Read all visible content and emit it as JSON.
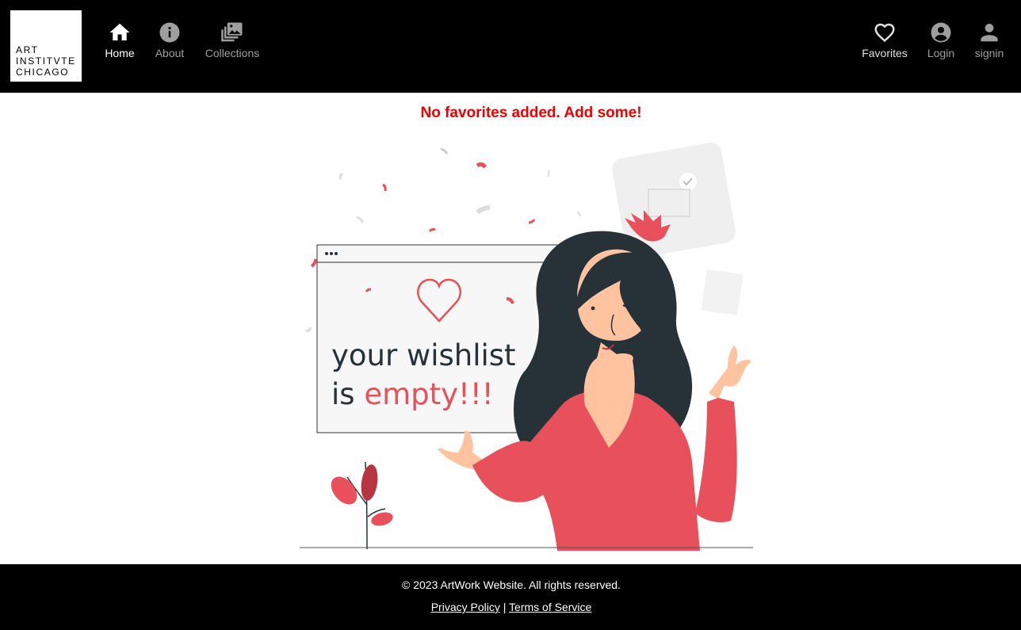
{
  "header": {
    "logo": {
      "lines": [
        "ART",
        "INSTITVTE",
        "CHICAGO"
      ]
    },
    "nav_left": [
      {
        "label": "Home",
        "icon": "home-icon",
        "active": true
      },
      {
        "label": "About",
        "icon": "info-icon",
        "active": false
      },
      {
        "label": "Collections",
        "icon": "collections-icon",
        "active": false
      }
    ],
    "nav_right": [
      {
        "label": "Favorites",
        "icon": "heart-outline-icon"
      },
      {
        "label": "Login",
        "icon": "account-circle-icon"
      },
      {
        "label": "signin",
        "icon": "person-icon"
      }
    ]
  },
  "main": {
    "empty_message": "No favorites added. Add some!",
    "illustration": {
      "line1": "your wishlist",
      "line2_prefix": "is ",
      "line2_accent": "empty!!!",
      "icon": "heart-outline-icon"
    }
  },
  "footer": {
    "copyright": "© 2023 ArtWork Website. All rights reserved.",
    "privacy_label": "Privacy Policy",
    "separator": "|",
    "terms_label": "Terms of Service"
  },
  "colors": {
    "header_bg": "#000000",
    "active_nav": "#ffffff",
    "inactive_nav": "#9e9e9e",
    "message": "#ee0000",
    "accent": "#e8505b",
    "hair": "#263238",
    "skin": "#ffc3a0"
  }
}
